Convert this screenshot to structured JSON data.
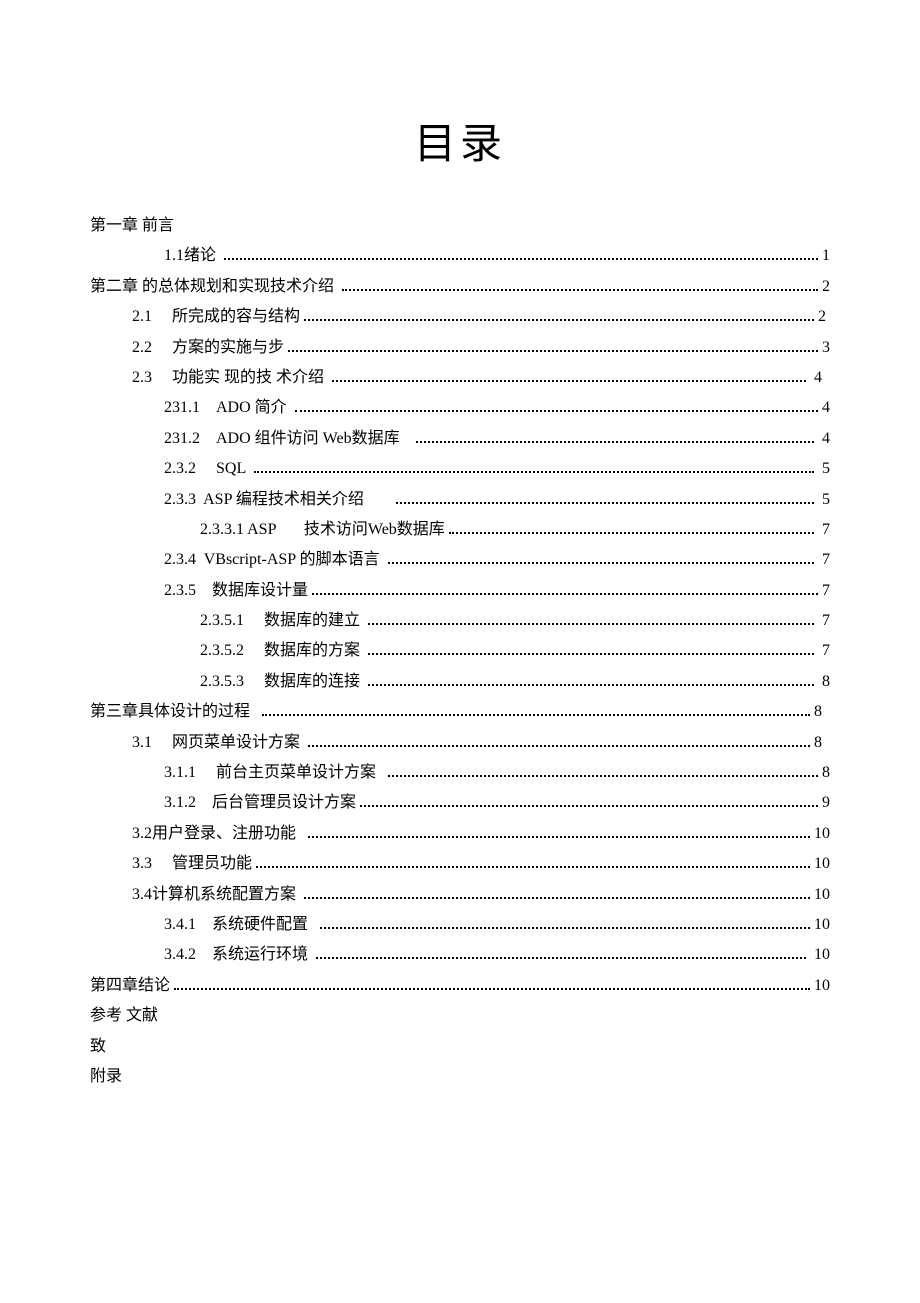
{
  "title": "目录",
  "entries": [
    {
      "kind": "plain",
      "indentClass": "ind0",
      "label": "第一章 前言"
    },
    {
      "kind": "dotted",
      "indentClass": "ind2",
      "label": "1.1绪论 ",
      "page": "1"
    },
    {
      "kind": "dotted",
      "indentClass": "ind0",
      "label": "第二章 的总体规划和实现技术介绍 ",
      "page": "2"
    },
    {
      "kind": "dotted",
      "indentClass": "ind1",
      "label": "2.1　 所完成的容与结构",
      "page": "2 "
    },
    {
      "kind": "dotted",
      "indentClass": "ind1",
      "label": "2.2　 方案的实施与步",
      "page": "3"
    },
    {
      "kind": "dotted",
      "indentClass": "ind1",
      "label": "2.3　 功能实 现的技 术介绍 ",
      "page": " 4  "
    },
    {
      "kind": "dotted",
      "indentClass": "ind2",
      "label": "231.1　ADO 简介 ",
      "page": "4"
    },
    {
      "kind": "dotted",
      "indentClass": "ind2",
      "label": "231.2　ADO 组件访问 Web数据库   ",
      "page": " 4"
    },
    {
      "kind": "dotted",
      "indentClass": "ind2",
      "label": "2.3.2　 SQL ",
      "page": " 5"
    },
    {
      "kind": "dotted",
      "indentClass": "ind2",
      "label": "2.3.3  ASP 编程技术相关介绍       ",
      "page": " 5"
    },
    {
      "kind": "dotted",
      "indentClass": "ind3",
      "label": "2.3.3.1 ASP　   技术访问Web数据库",
      "page": " 7"
    },
    {
      "kind": "dotted",
      "indentClass": "ind2",
      "label": "2.3.4  VBscript-ASP 的脚本语言 ",
      "page": " 7"
    },
    {
      "kind": "dotted",
      "indentClass": "ind2",
      "label": "2.3.5　数据库设计量",
      "page": "7"
    },
    {
      "kind": "dotted",
      "indentClass": "ind3",
      "label": "2.3.5.1　 数据库的建立 ",
      "page": " 7"
    },
    {
      "kind": "dotted",
      "indentClass": "ind3",
      "label": "2.3.5.2　 数据库的方案 ",
      "page": " 7"
    },
    {
      "kind": "dotted",
      "indentClass": "ind3",
      "label": "2.3.5.3　 数据库的连接 ",
      "page": " 8"
    },
    {
      "kind": "dotted",
      "indentClass": "ind0",
      "label": "第三章具体设计的过程  ",
      "page": "8  "
    },
    {
      "kind": "dotted",
      "indentClass": "ind1",
      "label": "3.1　 网页菜单设计方案 ",
      "page": "8  "
    },
    {
      "kind": "dotted",
      "indentClass": "ind2",
      "label": "3.1.1　 前台主页菜单设计方案  ",
      "page": "8"
    },
    {
      "kind": "dotted",
      "indentClass": "ind2",
      "label": "3.1.2　后台管理员设计方案",
      "page": "9"
    },
    {
      "kind": "dotted",
      "indentClass": "ind1",
      "label": "3.2用户登录、注册功能  ",
      "page": "10"
    },
    {
      "kind": "dotted",
      "indentClass": "ind1",
      "label": "3.3　 管理员功能",
      "page": "10"
    },
    {
      "kind": "dotted",
      "indentClass": "ind1",
      "label": "3.4计算机系统配置方案 ",
      "page": "10"
    },
    {
      "kind": "dotted",
      "indentClass": "ind2",
      "label": "3.4.1　系统硬件配置  ",
      "page": "10"
    },
    {
      "kind": "dotted",
      "indentClass": "ind2",
      "label": "3.4.2　系统运行环境 ",
      "page": " 10"
    },
    {
      "kind": "dotted",
      "indentClass": "ind0",
      "label": "第四章结论",
      "page": "10"
    },
    {
      "kind": "plain",
      "indentClass": "ind0",
      "label": "参考 文献"
    },
    {
      "kind": "plain",
      "indentClass": "ind0",
      "label": "致"
    },
    {
      "kind": "plain",
      "indentClass": "ind0",
      "label": "附录"
    }
  ]
}
